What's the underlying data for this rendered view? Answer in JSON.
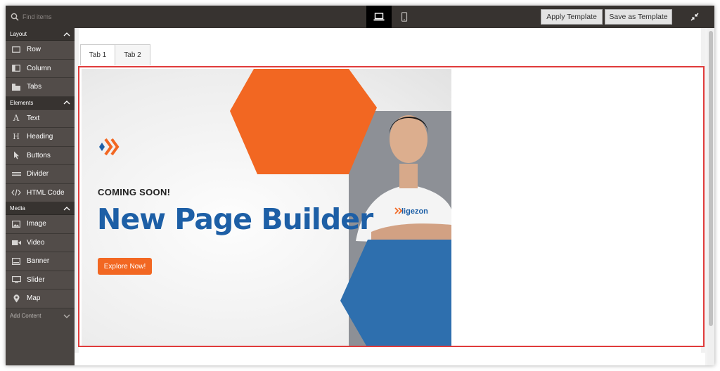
{
  "search": {
    "placeholder": "Find items"
  },
  "toolbar": {
    "apply_label": "Apply Template",
    "save_label": "Save as Template",
    "desktop_icon": "laptop-icon",
    "mobile_icon": "phone-icon",
    "fullscreen_icon": "collapse-icon"
  },
  "sidebar": {
    "sections": [
      {
        "title": "Layout",
        "items": [
          {
            "label": "Row",
            "icon": "row-icon"
          },
          {
            "label": "Column",
            "icon": "column-icon"
          },
          {
            "label": "Tabs",
            "icon": "tabs-icon"
          }
        ]
      },
      {
        "title": "Elements",
        "items": [
          {
            "label": "Text",
            "icon": "text-icon"
          },
          {
            "label": "Heading",
            "icon": "heading-icon"
          },
          {
            "label": "Buttons",
            "icon": "pointer-icon"
          },
          {
            "label": "Divider",
            "icon": "divider-icon"
          },
          {
            "label": "HTML Code",
            "icon": "code-icon"
          }
        ]
      },
      {
        "title": "Media",
        "items": [
          {
            "label": "Image",
            "icon": "image-icon"
          },
          {
            "label": "Video",
            "icon": "video-icon"
          },
          {
            "label": "Banner",
            "icon": "banner-icon"
          },
          {
            "label": "Slider",
            "icon": "slider-icon"
          },
          {
            "label": "Map",
            "icon": "map-pin-icon"
          }
        ]
      }
    ],
    "add_content": "Add Content"
  },
  "stage": {
    "tabs": [
      {
        "label": "Tab 1"
      },
      {
        "label": "Tab 2"
      }
    ]
  },
  "banner": {
    "eyebrow": "COMING SOON!",
    "headline": "New Page Builder",
    "cta": "Explore Now!",
    "shirt_logo": "ligezon",
    "colors": {
      "orange": "#f26722",
      "blue": "#1d5fa6"
    }
  }
}
